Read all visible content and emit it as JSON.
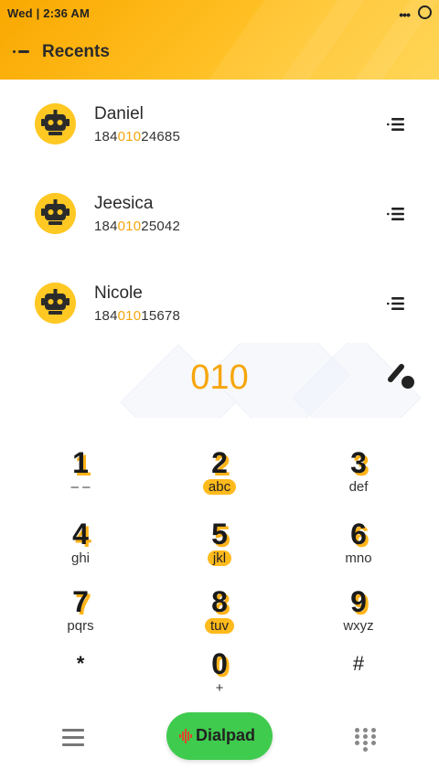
{
  "status_bar": {
    "time": "Wed  |  2:36 AM",
    "dots": "•••"
  },
  "header": {
    "title": "Recents",
    "back_icon": "back-arrow-icon"
  },
  "recents": [
    {
      "name": "Daniel",
      "number_pre": "184",
      "number_match": "010",
      "number_post": "24685"
    },
    {
      "name": "Jeesica",
      "number_pre": "184",
      "number_match": "010",
      "number_post": "25042"
    },
    {
      "name": "Nicole",
      "number_pre": "184",
      "number_match": "010",
      "number_post": "15678"
    }
  ],
  "display": {
    "dialed": "010"
  },
  "keypad": [
    {
      "digit": "1",
      "letters": "– –",
      "highlight": false
    },
    {
      "digit": "2",
      "letters": "abc",
      "highlight": true
    },
    {
      "digit": "3",
      "letters": "def",
      "highlight": false
    },
    {
      "digit": "4",
      "letters": "ghi",
      "highlight": false
    },
    {
      "digit": "5",
      "letters": "jkl",
      "highlight": true
    },
    {
      "digit": "6",
      "letters": "mno",
      "highlight": false
    },
    {
      "digit": "7",
      "letters": "pqrs",
      "highlight": false
    },
    {
      "digit": "8",
      "letters": "tuv",
      "highlight": true
    },
    {
      "digit": "9",
      "letters": "wxyz",
      "highlight": false
    },
    {
      "digit": "*",
      "letters": "",
      "highlight": false
    },
    {
      "digit": "0",
      "letters": "+",
      "highlight": false
    },
    {
      "digit": "#",
      "letters": "",
      "highlight": false
    }
  ],
  "bottom_bar": {
    "dialpad_label": "Dialpad"
  },
  "colors": {
    "accent": "#f6a60c",
    "header": "#ffbd1f",
    "dialpad_green": "#3fcb4e",
    "avatar": "#ffc823"
  }
}
